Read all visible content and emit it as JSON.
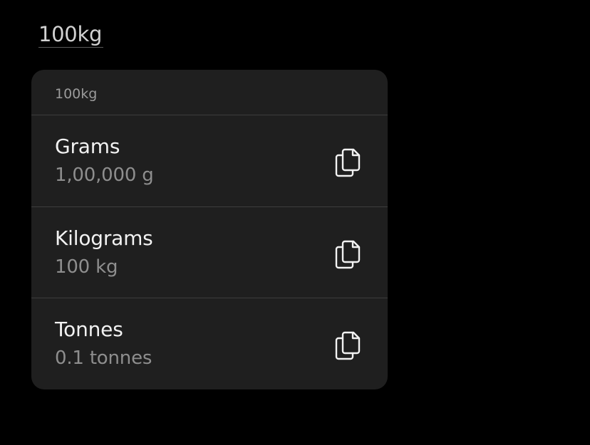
{
  "input": {
    "value": "100kg"
  },
  "popover": {
    "header": "100kg",
    "units": [
      {
        "name": "Grams",
        "value": "1,00,000 g",
        "icon": "copy-icon"
      },
      {
        "name": "Kilograms",
        "value": "100 kg",
        "icon": "copy-icon"
      },
      {
        "name": "Tonnes",
        "value": "0.1 tonnes",
        "icon": "copy-icon"
      }
    ]
  },
  "colors": {
    "background": "#000000",
    "popover": "#1f1f1f",
    "primary_text": "#f2f2f2",
    "secondary_text": "#8e8e8e"
  }
}
